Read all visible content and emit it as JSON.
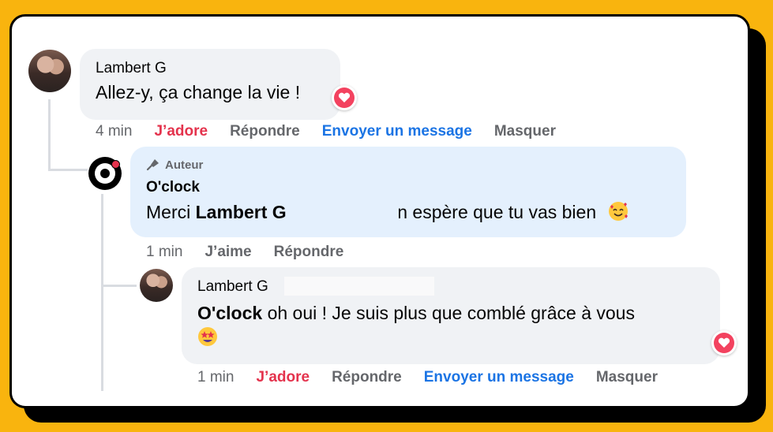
{
  "comment1": {
    "author": "Lambert G",
    "text": "Allez-y, ça change la vie !",
    "actions": {
      "time": "4 min",
      "love": "J’adore",
      "reply": "Répondre",
      "message": "Envoyer un message",
      "hide": "Masquer"
    }
  },
  "comment2": {
    "badge": "Auteur",
    "author": "O'clock",
    "text_pre": "Merci ",
    "text_name": "Lambert G",
    "text_post": ", on espère que tu vas bien",
    "actions": {
      "time": "1 min",
      "like": "J’aime",
      "reply": "Répondre"
    }
  },
  "comment3": {
    "author": "Lambert G",
    "text_name": "O'clock",
    "text_post": " oh oui ! Je suis plus que comblé grâce à vous",
    "actions": {
      "time": "1 min",
      "love": "J’adore",
      "reply": "Répondre",
      "message": "Envoyer un message",
      "hide": "Masquer"
    }
  },
  "colors": {
    "background": "#f9b40e",
    "love": "#e4334d",
    "link": "#1b74e4",
    "muted": "#65676b"
  }
}
